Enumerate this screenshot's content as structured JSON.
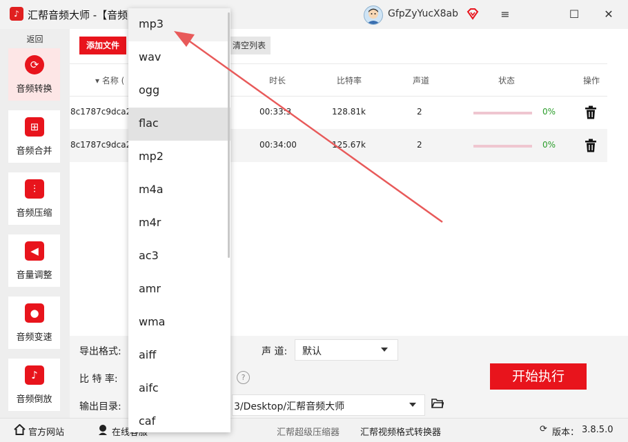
{
  "titlebar": {
    "app_title": "汇帮音频大师  -【音频",
    "username": "GfpZyYucX8ab",
    "menu_icon": "≡",
    "maximize_icon": "☐",
    "close_icon": "✕",
    "logo_text": "♪"
  },
  "sidebar": {
    "back_label": "返回",
    "items": [
      {
        "label": "音频转换",
        "icon": "audio-convert-icon",
        "glyph": "⟳"
      },
      {
        "label": "音频合并",
        "icon": "audio-merge-icon",
        "glyph": "⊞"
      },
      {
        "label": "音频压缩",
        "icon": "audio-compress-icon",
        "glyph": "⫶"
      },
      {
        "label": "音量调整",
        "icon": "volume-icon",
        "glyph": "◀"
      },
      {
        "label": "音频变速",
        "icon": "microphone-icon",
        "glyph": "●"
      },
      {
        "label": "音频倒放",
        "icon": "music-note-icon",
        "glyph": "♪"
      }
    ]
  },
  "toolbar": {
    "add_file_label": "添加文件",
    "clear_list_label": "清空列表"
  },
  "table": {
    "columns": {
      "name": "▾ 名称 (",
      "duration": "时长",
      "bitrate": "比特率",
      "channels": "声道",
      "status": "状态",
      "actions": "操作"
    },
    "rows": [
      {
        "name": "8c1787c9dca2",
        "duration": "00:33:3",
        "bitrate": "128.81k",
        "channels": "2",
        "progress": 0,
        "percent": "0%"
      },
      {
        "name": "8c1787c9dca2",
        "duration": "00:34:00",
        "bitrate": "125.67k",
        "channels": "2",
        "progress": 0,
        "percent": "0%"
      }
    ]
  },
  "settings": {
    "export_format_label": "导出格式:",
    "channel_label": "声 道:",
    "channel_value": "默认",
    "bitrate_label": "比 特 率:",
    "output_dir_label": "输出目录:",
    "output_dir_value": "3/Desktop/汇帮音频大师",
    "help_icon": "?",
    "start_label": "开始执行"
  },
  "statusbar": {
    "website": "官方网站",
    "online_service": "在线客服",
    "compressor": "汇帮超级压缩器",
    "video_converter": "汇帮视频格式转换器",
    "version_label": "版本：",
    "version": "3.8.5.0"
  },
  "format_dropdown": {
    "options": [
      "mp3",
      "wav",
      "ogg",
      "flac",
      "mp2",
      "m4a",
      "m4r",
      "ac3",
      "amr",
      "wma",
      "aiff",
      "aifc",
      "caf"
    ],
    "selected": "flac",
    "hovered": "mp3"
  },
  "colors": {
    "accent": "#e8141c",
    "success": "#2a9d2a",
    "annotation_arrow": "#e85a5a"
  }
}
